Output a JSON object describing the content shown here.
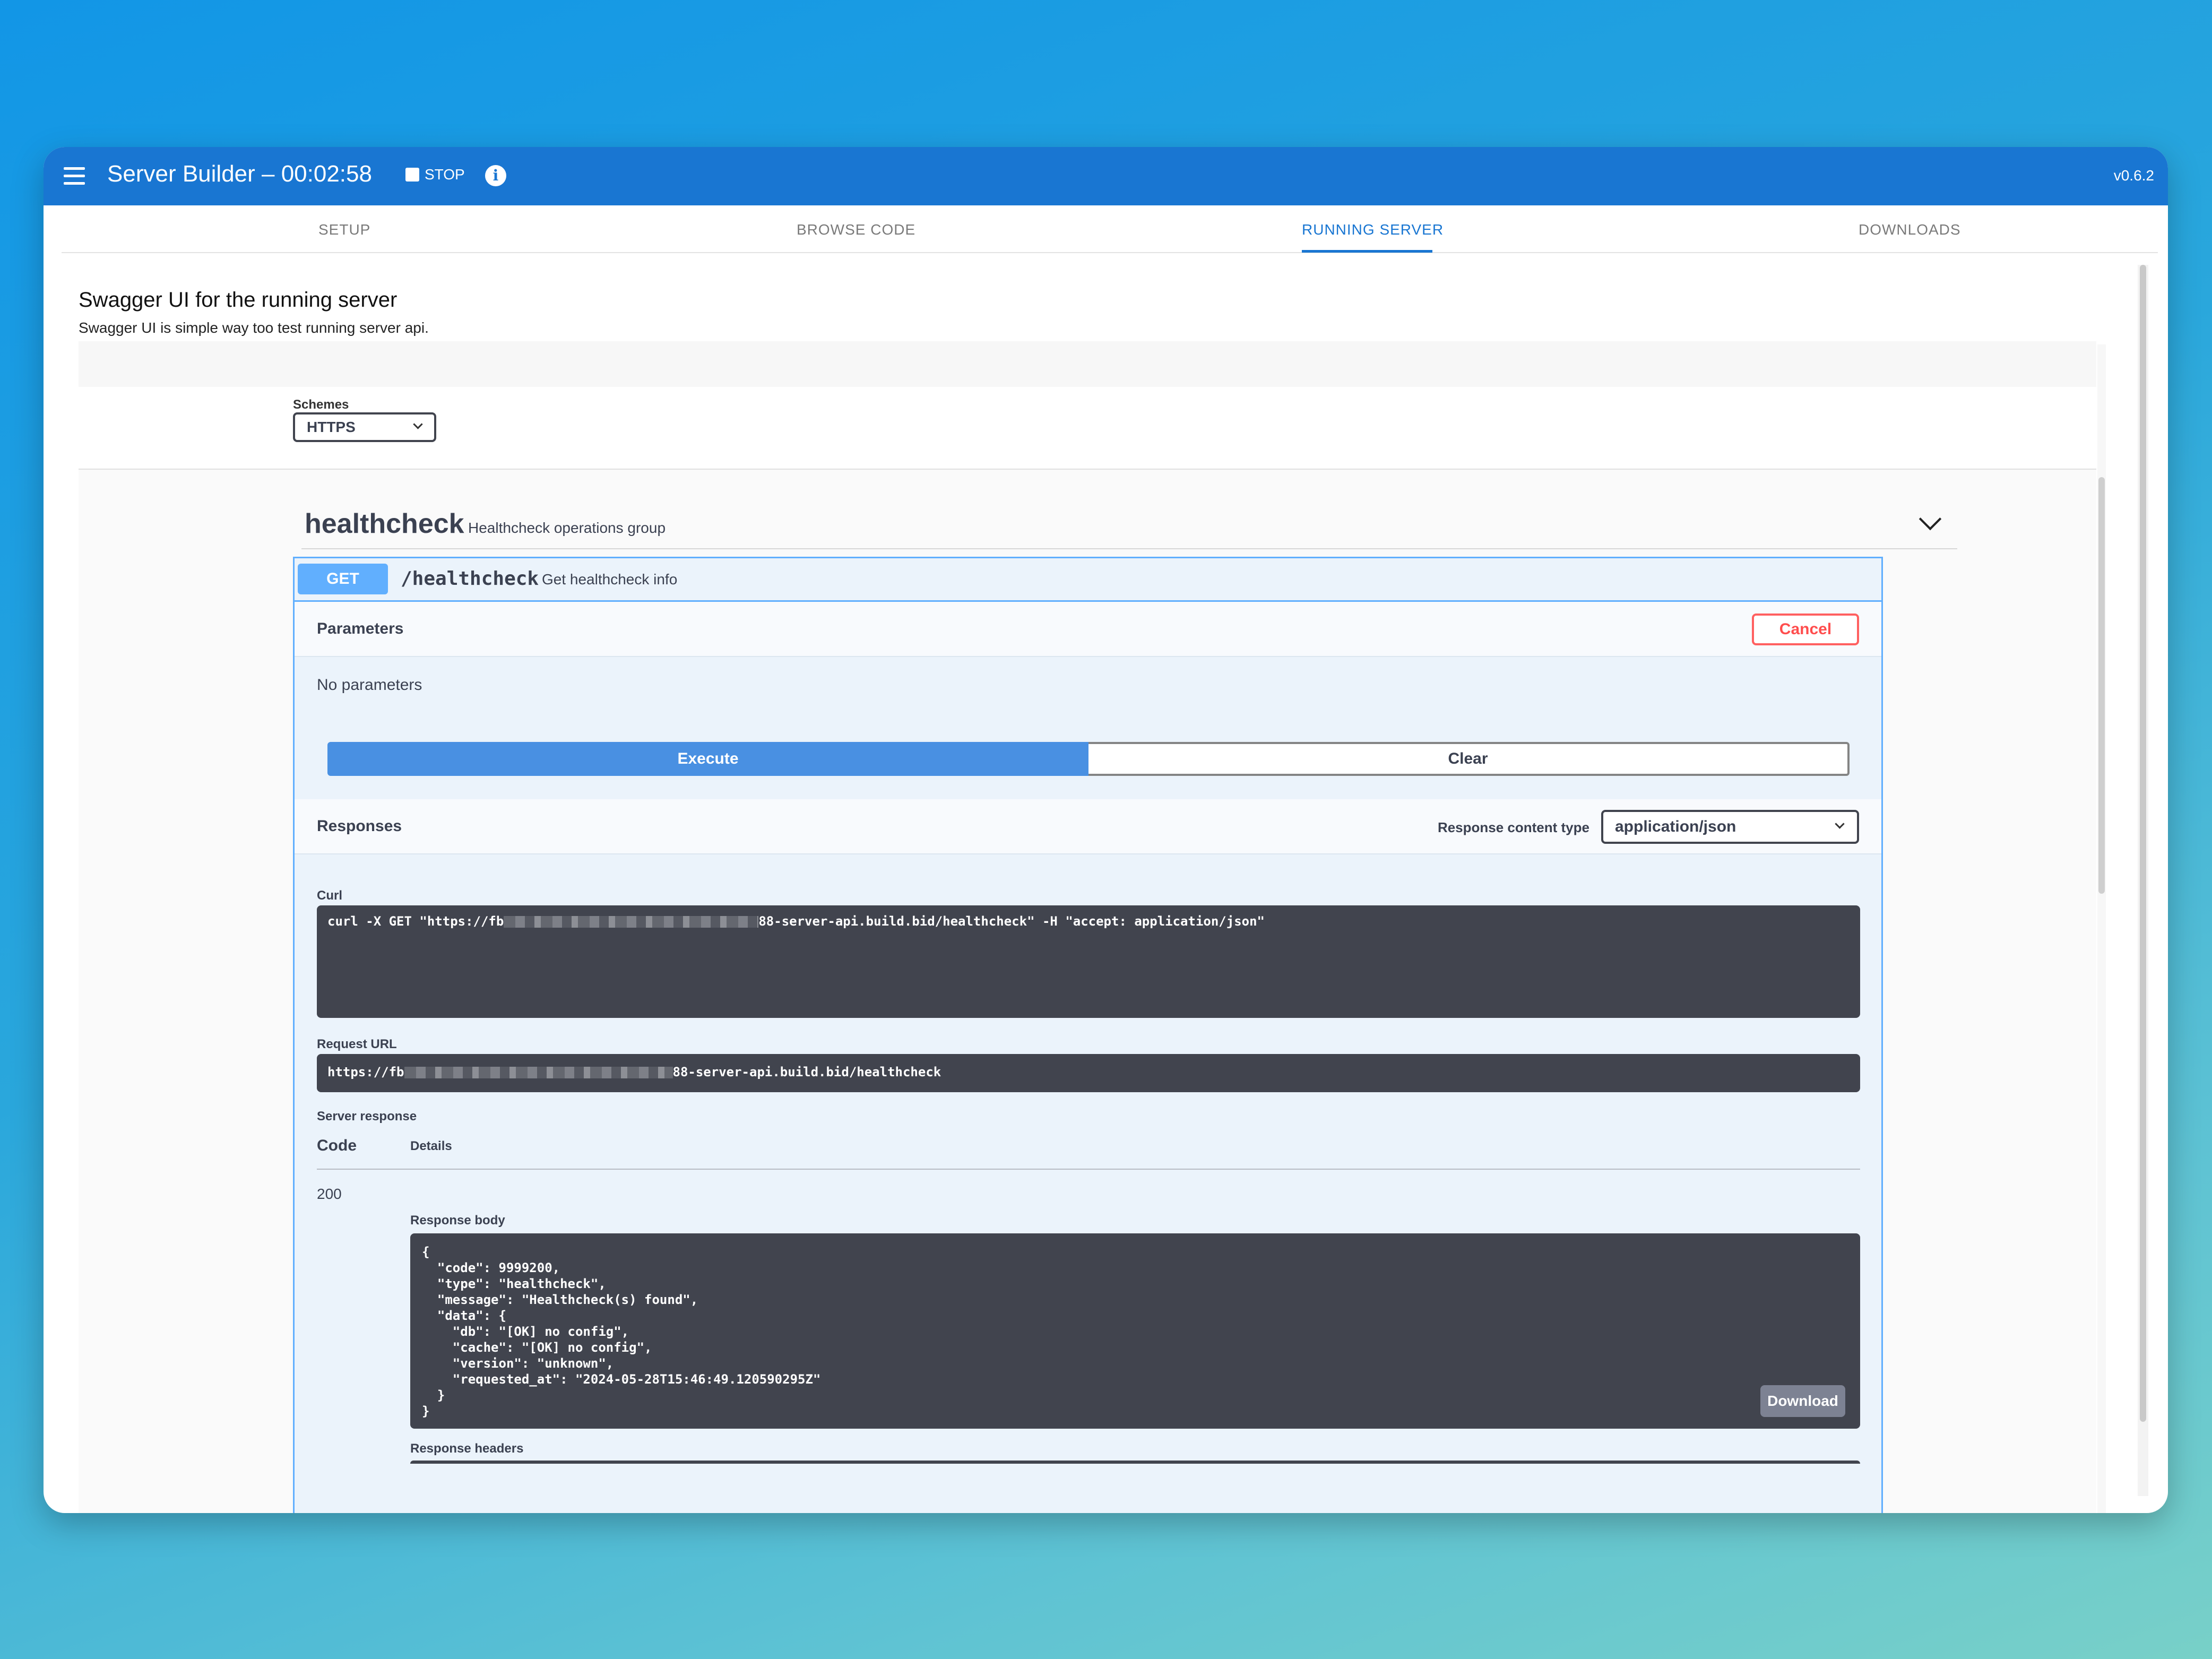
{
  "app": {
    "title": "Server Builder – 00:02:58",
    "stop_label": "STOP",
    "info_glyph": "i",
    "version": "v0.6.2",
    "accent_color": "#1976d2"
  },
  "tabs": [
    {
      "label": "SETUP",
      "active": false
    },
    {
      "label": "BROWSE CODE",
      "active": false
    },
    {
      "label": "RUNNING SERVER",
      "active": true
    },
    {
      "label": "DOWNLOADS",
      "active": false
    }
  ],
  "page": {
    "title": "Swagger UI for the running server",
    "subtitle": "Swagger UI is simple way too test running server api."
  },
  "swagger": {
    "schemes_label": "Schemes",
    "schemes_value": "HTTPS",
    "tag": {
      "name": "healthcheck",
      "description": "Healthcheck operations group"
    },
    "operation": {
      "method": "GET",
      "method_color": "#61affe",
      "path": "/healthcheck",
      "summary": "Get healthcheck info",
      "parameters_title": "Parameters",
      "cancel_label": "Cancel",
      "no_parameters": "No parameters",
      "execute_label": "Execute",
      "clear_label": "Clear",
      "responses_title": "Responses",
      "response_content_type_label": "Response content type",
      "response_content_type_value": "application/json",
      "curl_label": "Curl",
      "curl_prefix": "curl -X GET \"https://fb",
      "curl_suffix": "88-server-api.build.bid/healthcheck\" -H \"accept: application/json\"",
      "request_url_label": "Request URL",
      "request_url_prefix": "https://fb",
      "request_url_suffix": "88-server-api.build.bid/healthcheck",
      "server_response_label": "Server response",
      "code_header": "Code",
      "details_header": "Details",
      "response_code": "200",
      "response_body_label": "Response body",
      "response_body": "{\n  \"code\": 9999200,\n  \"type\": \"healthcheck\",\n  \"message\": \"Healthcheck(s) found\",\n  \"data\": {\n    \"db\": \"[OK] no config\",\n    \"cache\": \"[OK] no config\",\n    \"version\": \"unknown\",\n    \"requested_at\": \"2024-05-28T15:46:49.120590295Z\"\n  }\n}",
      "download_label": "Download",
      "response_headers_label": "Response headers"
    }
  }
}
